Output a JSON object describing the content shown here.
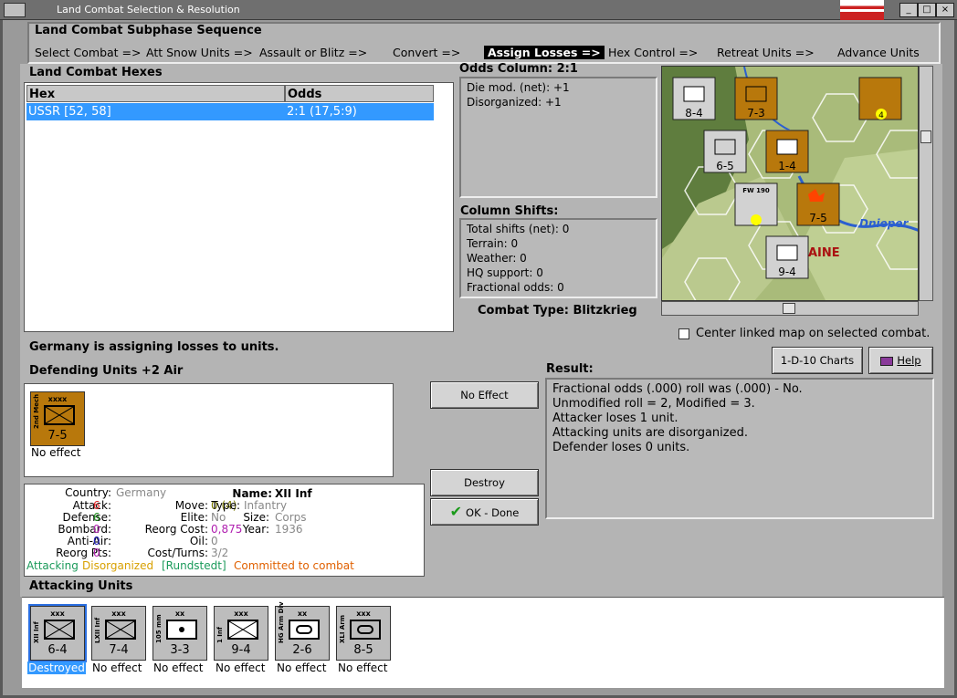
{
  "window": {
    "title": "Land Combat Selection & Resolution"
  },
  "phase": {
    "heading": "Land Combat Subphase Sequence",
    "steps": [
      "Select Combat =>",
      "Att Snow Units =>",
      "Assault or Blitz =>",
      "Convert =>",
      "Assign Losses =>",
      "Hex Control =>",
      "Retreat Units =>",
      "Advance Units"
    ],
    "active_index": 4
  },
  "hexes": {
    "heading": "Land Combat Hexes",
    "columns": [
      "Hex",
      "Odds"
    ],
    "rows": [
      [
        "USSR [52, 58]",
        "2:1 (17,5:9)"
      ]
    ]
  },
  "odds": {
    "heading": "Odds Column: 2:1",
    "lines": [
      "Die mod. (net): +1",
      "Disorganized: +1"
    ]
  },
  "shifts": {
    "heading": "Column Shifts:",
    "lines": [
      "Total shifts (net): 0",
      "Terrain: 0",
      "Weather: 0",
      "HQ support: 0",
      "Fractional odds: 0"
    ]
  },
  "combat_type": "Combat Type:  Blitzkrieg",
  "center_map": "Center linked map on selected combat.",
  "status": "Germany is assigning losses to units.",
  "buttons": {
    "charts": "1-D-10 Charts",
    "help": "Help",
    "no_effect": "No Effect",
    "destroy": "Destroy",
    "ok": "OK - Done"
  },
  "defending": {
    "heading": "Defending Units +2 Air",
    "units": [
      {
        "side": "2nd Mech",
        "size": "xxxx",
        "strength": "7-5",
        "result": "No effect"
      }
    ]
  },
  "result": {
    "heading": "Result:",
    "lines": [
      "Fractional odds (.000) roll was (.000)  - No.",
      "Unmodified roll = 2, Modified = 3.",
      "Attacker loses 1 unit.",
      "Attacking units are disorganized.",
      "Defender loses 0 units."
    ]
  },
  "info": {
    "country_k": "Country:",
    "country_v": "Germany",
    "name_k": "Name:",
    "name_v": "XII Inf",
    "attack_k": "Attack:",
    "attack_v": "6",
    "move_k": "Move:",
    "move_v": "0 (4)",
    "type_k": "Type:",
    "type_v": "Infantry",
    "defense_k": "Defense:",
    "defense_v": "6",
    "elite_k": "Elite:",
    "elite_v": "No",
    "size_k": "Size:",
    "size_v": "Corps",
    "bombard_k": "Bombard:",
    "bombard_v": "0",
    "reorg_k": "Reorg Cost:",
    "reorg_v": "0,875",
    "year_k": "Year:",
    "year_v": "1936",
    "antiair_k": "Anti-Air:",
    "antiair_v": "0",
    "oil_k": "Oil:",
    "oil_v": "0",
    "reorgpts_k": "Reorg Pts:",
    "reorgpts_v": "0",
    "cost_k": "Cost/Turns:",
    "cost_v": "3/2",
    "s_attacking": "Attacking",
    "s_disorg": "Disorganized",
    "s_hq": "[Rundstedt]",
    "s_committed": "Committed to combat"
  },
  "attacking": {
    "heading": "Attacking Units",
    "units": [
      {
        "side": "XII Inf",
        "size": "xxx",
        "strength": "6-4",
        "result": "Destroyed"
      },
      {
        "side": "LXII Inf",
        "size": "xxx",
        "strength": "7-4",
        "result": "No effect"
      },
      {
        "side": "105 mm",
        "size": "xx",
        "strength": "3-3",
        "result": "No effect"
      },
      {
        "side": "1 Inf",
        "size": "xxx",
        "strength": "9-4",
        "result": "No effect"
      },
      {
        "side": "HG Arm Div",
        "size": "xx",
        "strength": "2-6",
        "result": "No effect"
      },
      {
        "side": "XLI Arm",
        "size": "xxx",
        "strength": "8-5",
        "result": "No effect"
      }
    ]
  },
  "map": {
    "labels": [
      "Dnieper",
      "AINE"
    ],
    "counters": [
      {
        "strength": "8-4"
      },
      {
        "strength": "7-3"
      },
      {
        "strength": "4"
      },
      {
        "strength": "6-5"
      },
      {
        "strength": "1-4"
      },
      {
        "strength": "FW 190"
      },
      {
        "strength": "7-5"
      },
      {
        "strength": "9-4"
      }
    ]
  },
  "colors": {
    "counter_german": "#bdbdbd",
    "counter_soviet": "#b8780c",
    "select": "#3399ff"
  }
}
